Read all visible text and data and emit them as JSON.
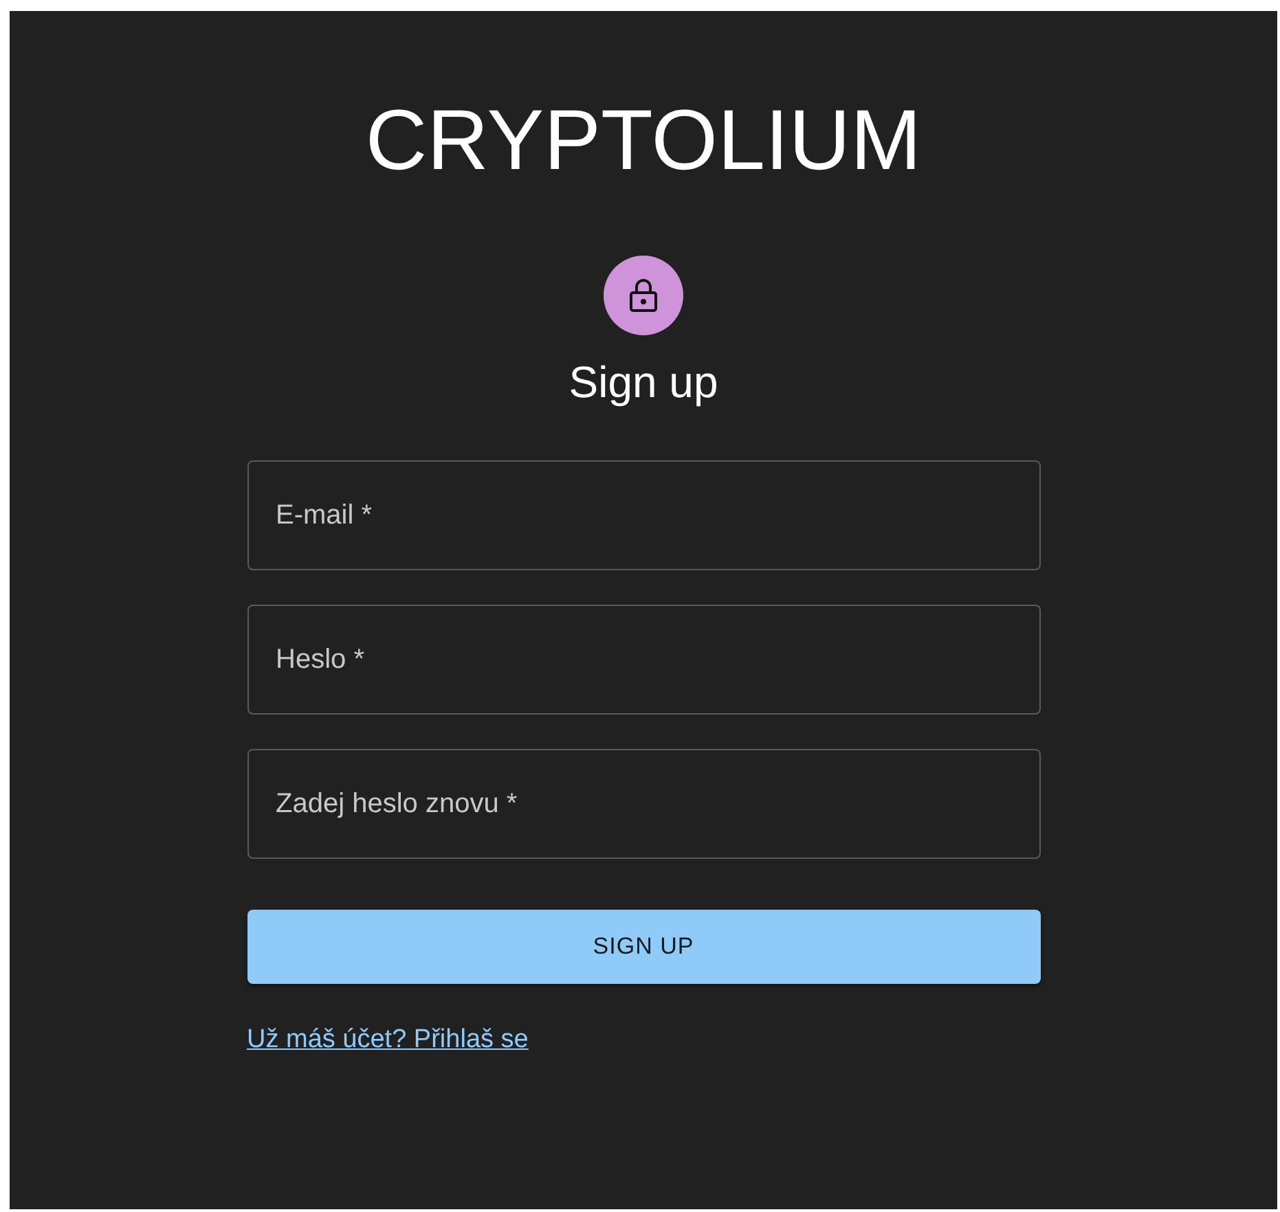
{
  "brand": {
    "title": "CRYPTOLIUM"
  },
  "heading": "Sign up",
  "fields": [
    {
      "placeholder": "E-mail *"
    },
    {
      "placeholder": "Heslo *"
    },
    {
      "placeholder": "Zadej heslo znovu *"
    }
  ],
  "submit": "SIGN UP",
  "login_link": "Už máš účet? Přihlaš se"
}
